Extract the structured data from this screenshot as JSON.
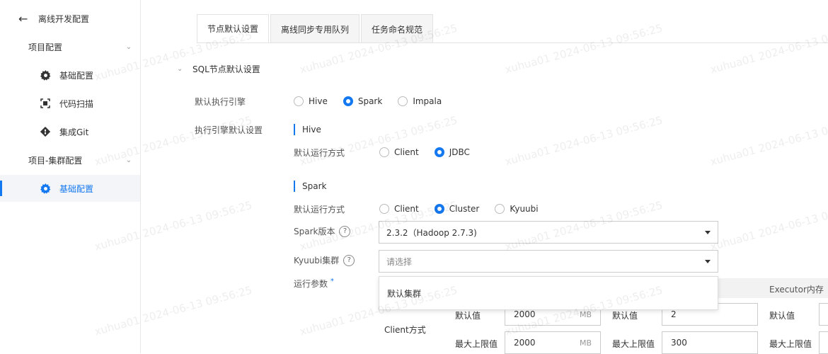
{
  "sidebar": {
    "back_label": "离线开发配置",
    "groups": [
      {
        "label": "项目配置",
        "items": [
          {
            "label": "基础配置",
            "icon": "gear-icon"
          },
          {
            "label": "代码扫描",
            "icon": "scan-icon"
          },
          {
            "label": "集成Git",
            "icon": "git-icon"
          }
        ]
      },
      {
        "label": "项目-集群配置",
        "items": [
          {
            "label": "基础配置",
            "icon": "gear-icon"
          }
        ]
      }
    ]
  },
  "tabs": [
    "节点默认设置",
    "离线同步专用队列",
    "任务命名规范"
  ],
  "section": {
    "title": "SQL节点默认设置"
  },
  "engine": {
    "label": "默认执行引擎",
    "options": [
      "Hive",
      "Spark",
      "Impala"
    ],
    "selected": "Spark"
  },
  "engine_defaults_label": "执行引擎默认设置",
  "hive": {
    "title": "Hive",
    "run_mode_label": "默认运行方式",
    "options": [
      "Client",
      "JDBC"
    ],
    "selected": "JDBC"
  },
  "spark": {
    "title": "Spark",
    "run_mode_label": "默认运行方式",
    "options": [
      "Client",
      "Cluster",
      "Kyuubi"
    ],
    "selected": "Cluster",
    "version_label": "Spark版本",
    "version_value": "2.3.2（Hadoop 2.7.3)",
    "kyuubi_label": "Kyuubi集群",
    "kyuubi_placeholder": "请选择",
    "dropdown_option": "默认集群",
    "params_label": "运行参数",
    "required_mark": "*"
  },
  "params_table": {
    "header_right": "Executor内存",
    "row_label": "Client方式",
    "default_label": "默认值",
    "max_label": "最大上限值",
    "unit": "MB",
    "col1": {
      "default": "2000",
      "max": "2000"
    },
    "col2": {
      "default": "2",
      "max": "300"
    }
  },
  "watermark": "xuhua01 2024-06-13 09:56:25",
  "colors": {
    "accent": "#1478f0"
  }
}
